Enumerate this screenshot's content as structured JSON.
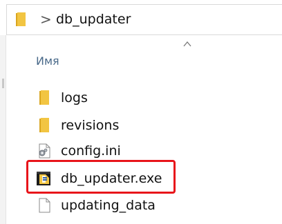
{
  "address_bar": {
    "folder_icon": "folder-icon",
    "chevron_icon": "chevron-right-icon",
    "chevron_glyph": ">",
    "path": "db_updater"
  },
  "column": {
    "name_header": "Имя",
    "sort_icon": "sort-ascending-caret-icon"
  },
  "files": [
    {
      "name": "logs",
      "icon": "folder-icon"
    },
    {
      "name": "revisions",
      "icon": "folder-icon"
    },
    {
      "name": "config.ini",
      "icon": "settings-file-icon"
    },
    {
      "name": "db_updater.exe",
      "icon": "application-exe-icon"
    },
    {
      "name": "updating_data",
      "icon": "blank-file-icon"
    }
  ],
  "highlight": {
    "target": "db_updater.exe",
    "color": "#e8141a"
  },
  "colors": {
    "folder": "#f2c542",
    "folder_dark": "#d9a520",
    "header_text": "#4a6a8a"
  }
}
